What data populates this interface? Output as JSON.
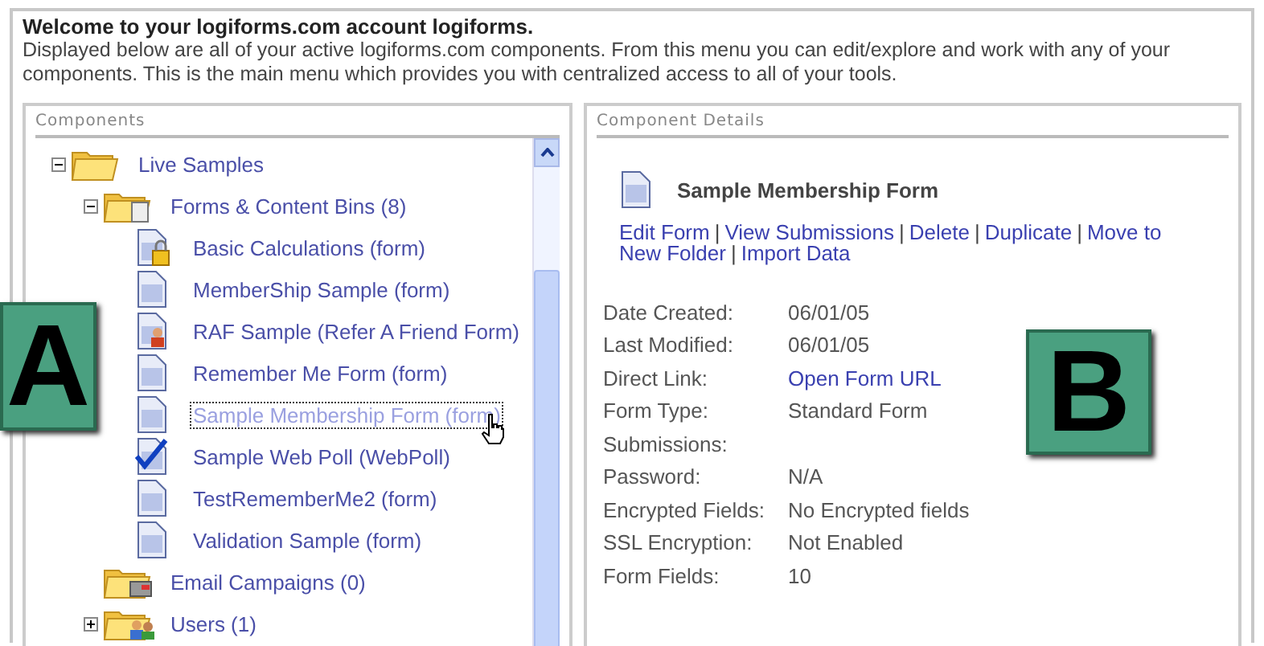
{
  "header": {
    "title": "Welcome to your logiforms.com account logiforms.",
    "description": "Displayed below are all of your active logiforms.com components. From this menu you can edit/explore and work with any of your components. This is the main menu which provides you with centralized access to all of your tools."
  },
  "components": {
    "heading": "Components",
    "tree": [
      {
        "label": "Live Samples",
        "kind": "folder",
        "expanded": true,
        "selected": false,
        "children": [
          {
            "label": "Forms & Content Bins (8)",
            "kind": "folder-forms",
            "expanded": true,
            "selected": false,
            "children": [
              {
                "label": "Basic Calculations (form)",
                "kind": "form-locked",
                "selected": false
              },
              {
                "label": "MemberShip Sample (form)",
                "kind": "form",
                "selected": false
              },
              {
                "label": "RAF Sample (Refer A Friend Form)",
                "kind": "form-person",
                "selected": false
              },
              {
                "label": "Remember Me Form (form)",
                "kind": "form",
                "selected": false
              },
              {
                "label": "Sample Membership Form (form)",
                "kind": "form",
                "selected": true
              },
              {
                "label": "Sample Web Poll (WebPoll)",
                "kind": "poll",
                "selected": false
              },
              {
                "label": "TestRememberMe2 (form)",
                "kind": "form",
                "selected": false
              },
              {
                "label": "Validation Sample (form)",
                "kind": "form",
                "selected": false
              }
            ]
          },
          {
            "label": "Email Campaigns (0)",
            "kind": "folder-mail",
            "selected": false
          },
          {
            "label": "Users (1)",
            "kind": "folder-users",
            "expanded": false,
            "selected": false
          }
        ]
      }
    ]
  },
  "details": {
    "heading": "Component Details",
    "title": "Sample Membership Form",
    "separator": "|",
    "action_lines": [
      [
        "Edit Form",
        "View Submissions",
        "Delete",
        "Duplicate",
        "Move to"
      ],
      [
        "New Folder",
        "Import Data"
      ]
    ],
    "fields": [
      {
        "label": "Date Created:",
        "value": "06/01/05",
        "kind": "text"
      },
      {
        "label": "Last Modified:",
        "value": "06/01/05",
        "kind": "text"
      },
      {
        "label": "Direct Link:",
        "value": "Open Form URL",
        "kind": "link"
      },
      {
        "label": "Form Type:",
        "value": "Standard Form",
        "kind": "text"
      },
      {
        "label": "Submissions:",
        "kind": "text"
      },
      {
        "label": "Password:",
        "value": "N/A",
        "kind": "text"
      },
      {
        "label": "Encrypted Fields:",
        "value": "No Encrypted fields",
        "kind": "text"
      },
      {
        "label": "SSL Encryption:",
        "value": "Not Enabled",
        "kind": "text"
      },
      {
        "label": "Form Fields:",
        "value": "10",
        "kind": "text"
      }
    ]
  },
  "callouts": [
    {
      "label": "A"
    },
    {
      "label": "B"
    }
  ]
}
